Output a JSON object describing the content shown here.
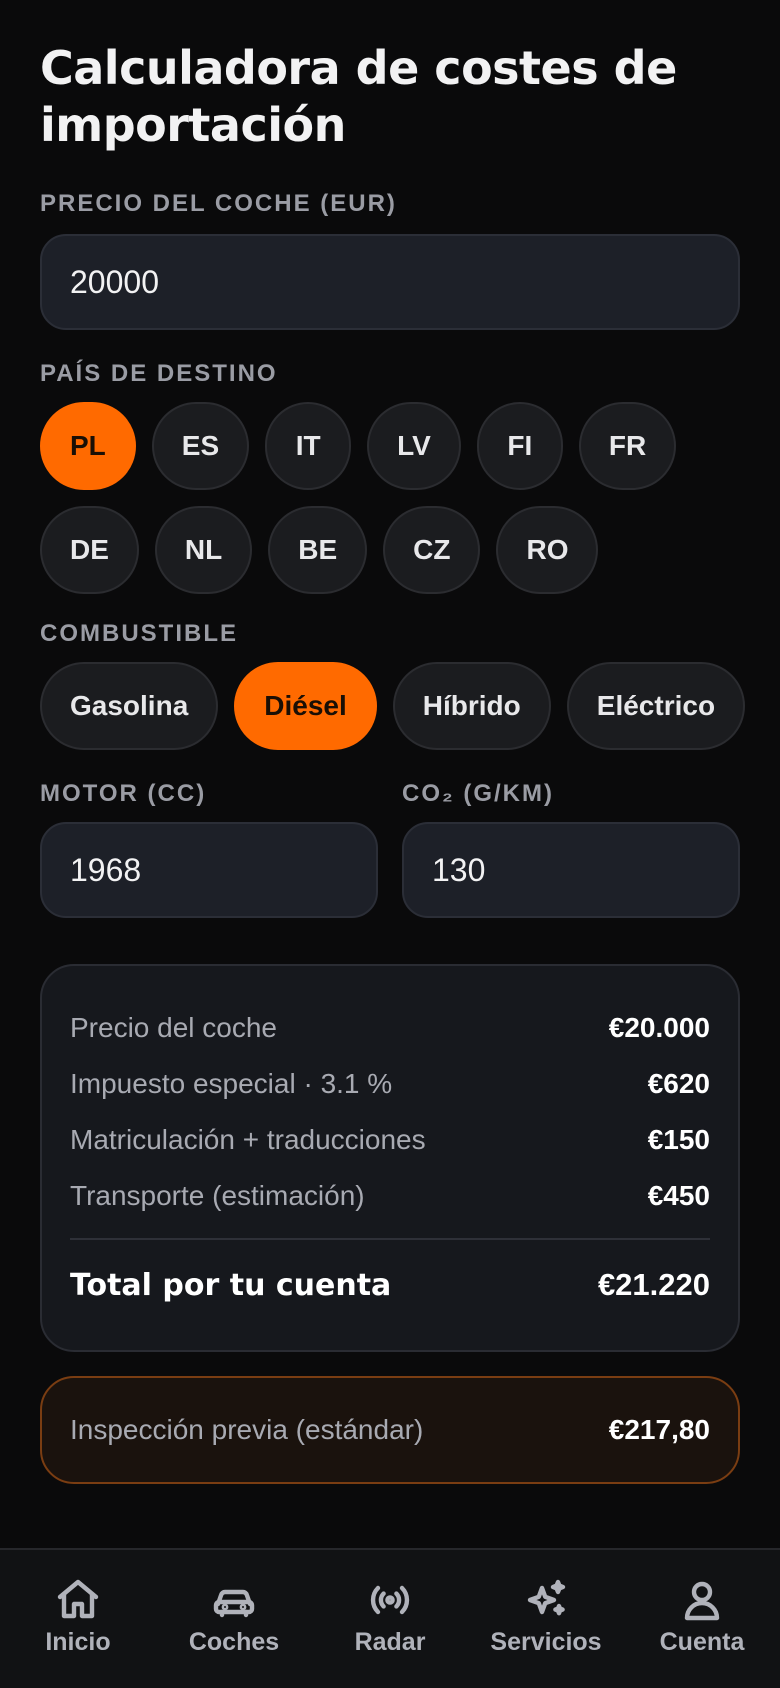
{
  "page": {
    "title": "Calculadora de costes de importación"
  },
  "price": {
    "label": "PRECIO DEL COCHE (EUR)",
    "value": "20000"
  },
  "country": {
    "label": "PAÍS DE DESTINO",
    "selected": "PL",
    "options": [
      "PL",
      "ES",
      "IT",
      "LV",
      "FI",
      "FR",
      "DE",
      "NL",
      "BE",
      "CZ",
      "RO"
    ]
  },
  "fuel": {
    "label": "COMBUSTIBLE",
    "selected": "Diésel",
    "options": [
      "Gasolina",
      "Diésel",
      "Híbrido",
      "Eléctrico"
    ]
  },
  "engine": {
    "label": "MOTOR (CC)",
    "value": "1968"
  },
  "co2": {
    "label": "CO₂ (G/KM)",
    "value": "130"
  },
  "summary": {
    "rows": [
      {
        "label": "Precio del coche",
        "value": "€20.000"
      },
      {
        "label": "Impuesto especial · 3.1 %",
        "value": "€620"
      },
      {
        "label": "Matriculación + traducciones",
        "value": "€150"
      },
      {
        "label": "Transporte (estimación)",
        "value": "€450"
      }
    ],
    "total_label": "Total por tu cuenta",
    "total_value": "€21.220"
  },
  "extras": {
    "rows": [
      {
        "label": "Inspección previa (estándar)",
        "value": "€217,80"
      }
    ]
  },
  "nav": {
    "items": [
      {
        "label": "Inicio",
        "icon": "home-icon"
      },
      {
        "label": "Coches",
        "icon": "car-icon"
      },
      {
        "label": "Radar",
        "icon": "radar-icon"
      },
      {
        "label": "Servicios",
        "icon": "sparkles-icon"
      },
      {
        "label": "Cuenta",
        "icon": "user-icon"
      }
    ]
  },
  "colors": {
    "accent": "#ff6a00",
    "background": "#0a0a0b",
    "card": "#16181d"
  }
}
